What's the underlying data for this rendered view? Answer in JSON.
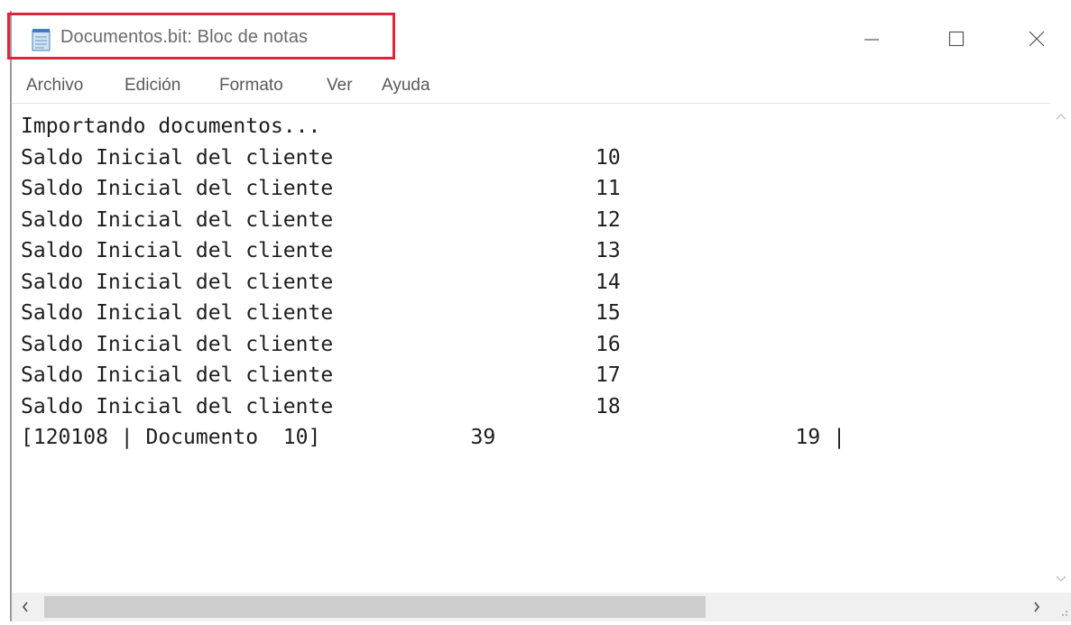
{
  "window": {
    "title": "Documentos.bit: Bloc de notas",
    "app_icon": "notepad-icon",
    "controls": {
      "minimize_icon": "minimize-icon",
      "maximize_icon": "maximize-icon",
      "close_icon": "close-icon"
    },
    "highlight_color": "#e0243c"
  },
  "menu": {
    "items": [
      "Archivo",
      "Edición",
      "Formato",
      "Ver",
      "Ayuda"
    ]
  },
  "editor": {
    "lines": [
      "Importando documentos...",
      "Saldo Inicial del cliente                     10",
      "Saldo Inicial del cliente                     11",
      "Saldo Inicial del cliente                     12",
      "Saldo Inicial del cliente                     13",
      "Saldo Inicial del cliente                     14",
      "Saldo Inicial del cliente                     15",
      "Saldo Inicial del cliente                     16",
      "Saldo Inicial del cliente                     17",
      "Saldo Inicial del cliente                     18",
      "[120108 | Documento  10]            39                        19 |"
    ]
  },
  "scrollbars": {
    "up_icon": "chevron-up-icon",
    "down_icon": "chevron-down-icon",
    "left_icon": "chevron-left-icon",
    "right_icon": "chevron-right-icon",
    "grip_icon": "resize-grip-icon"
  }
}
